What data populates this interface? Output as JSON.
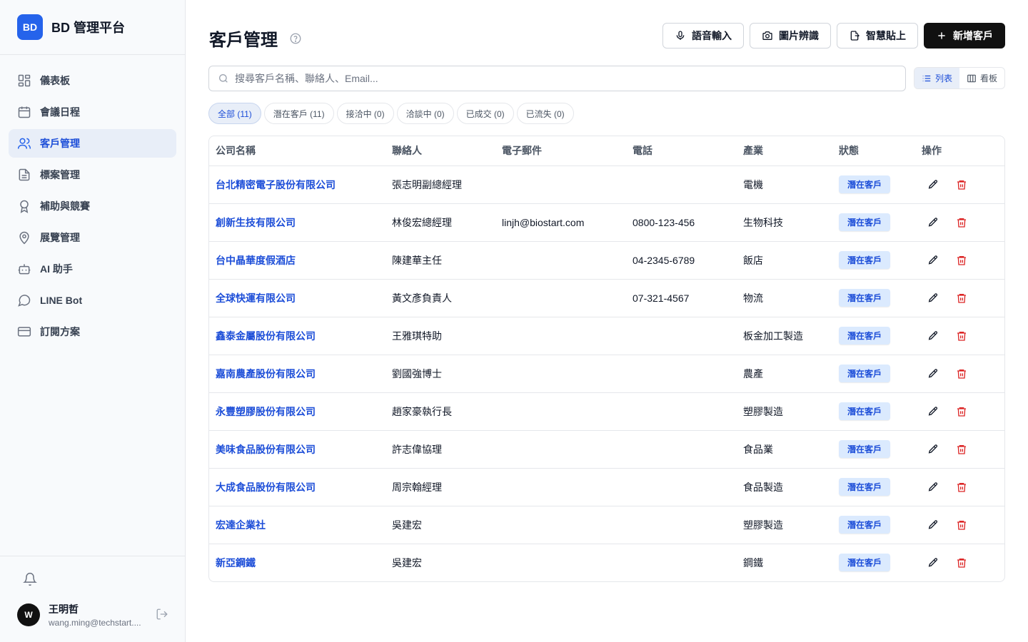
{
  "brand": {
    "logo": "BD",
    "name": "BD 管理平台"
  },
  "sidebar": {
    "items": [
      {
        "label": "儀表板",
        "icon": "dashboard-icon"
      },
      {
        "label": "會議日程",
        "icon": "calendar-icon"
      },
      {
        "label": "客戶管理",
        "icon": "users-icon",
        "active": true
      },
      {
        "label": "標案管理",
        "icon": "file-icon"
      },
      {
        "label": "補助與競賽",
        "icon": "award-icon"
      },
      {
        "label": "展覽管理",
        "icon": "map-pin-icon"
      },
      {
        "label": "AI 助手",
        "icon": "bot-icon"
      },
      {
        "label": "LINE Bot",
        "icon": "chat-bubble-icon"
      },
      {
        "label": "訂閱方案",
        "icon": "credit-card-icon"
      }
    ]
  },
  "user": {
    "initial": "W",
    "name": "王明哲",
    "email": "wang.ming@techstart...."
  },
  "header": {
    "title": "客戶管理",
    "buttons": {
      "voice": "語音輸入",
      "image": "圖片辨識",
      "paste": "智慧貼上",
      "add": "新增客戶"
    }
  },
  "search": {
    "placeholder": "搜尋客戶名稱、聯絡人、Email..."
  },
  "view": {
    "list": "列表",
    "board": "看板"
  },
  "filters": [
    "全部 (11)",
    "潛在客戶 (11)",
    "接洽中 (0)",
    "洽談中 (0)",
    "已成交 (0)",
    "已流失 (0)"
  ],
  "table": {
    "columns": [
      "公司名稱",
      "聯絡人",
      "電子郵件",
      "電話",
      "產業",
      "狀態",
      "操作"
    ],
    "rows": [
      {
        "company": "台北精密電子股份有限公司",
        "contact": "張志明副總經理",
        "email": "",
        "phone": "",
        "industry": "電機",
        "status": "潛在客戶"
      },
      {
        "company": "創新生技有限公司",
        "contact": "林俊宏總經理",
        "email": "linjh@biostart.com",
        "phone": "0800-123-456",
        "industry": "生物科技",
        "status": "潛在客戶"
      },
      {
        "company": "台中晶華度假酒店",
        "contact": "陳建華主任",
        "email": "",
        "phone": "04-2345-6789",
        "industry": "飯店",
        "status": "潛在客戶"
      },
      {
        "company": "全球快運有限公司",
        "contact": "黃文彥負責人",
        "email": "",
        "phone": "07-321-4567",
        "industry": "物流",
        "status": "潛在客戶"
      },
      {
        "company": "鑫泰金屬股份有限公司",
        "contact": "王雅琪特助",
        "email": "",
        "phone": "",
        "industry": "板金加工製造",
        "status": "潛在客戶"
      },
      {
        "company": "嘉南農產股份有限公司",
        "contact": "劉國強博士",
        "email": "",
        "phone": "",
        "industry": "農產",
        "status": "潛在客戶"
      },
      {
        "company": "永豐塑膠股份有限公司",
        "contact": "趙家豪執行長",
        "email": "",
        "phone": "",
        "industry": "塑膠製造",
        "status": "潛在客戶"
      },
      {
        "company": "美味食品股份有限公司",
        "contact": "許志偉協理",
        "email": "",
        "phone": "",
        "industry": "食品業",
        "status": "潛在客戶"
      },
      {
        "company": "大成食品股份有限公司",
        "contact": "周宗翰經理",
        "email": "",
        "phone": "",
        "industry": "食品製造",
        "status": "潛在客戶"
      },
      {
        "company": "宏達企業社",
        "contact": "吳建宏",
        "email": "",
        "phone": "",
        "industry": "塑膠製造",
        "status": "潛在客戶"
      },
      {
        "company": "新亞鋼鐵",
        "contact": "吳建宏",
        "email": "",
        "phone": "",
        "industry": "鋼鐵",
        "status": "潛在客戶"
      }
    ]
  },
  "colors": {
    "accent": "#2563eb",
    "link": "#1d4ed8",
    "badge_bg": "#dbeafe",
    "danger": "#dc2626",
    "primary_button": "#111111"
  }
}
